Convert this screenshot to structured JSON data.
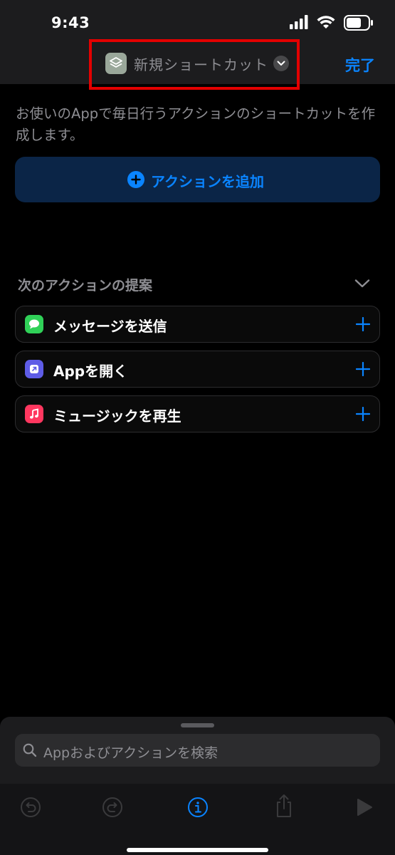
{
  "status_bar": {
    "time": "9:43"
  },
  "nav": {
    "title": "新規ショートカット",
    "done_label": "完了",
    "icon": "shortcuts-stack-icon"
  },
  "description": "お使いのAppで毎日行うアクションのショートカットを作成します。",
  "add_action": {
    "label": "アクションを追加"
  },
  "suggestions": {
    "header": "次のアクションの提案",
    "items": [
      {
        "label": "メッセージを送信",
        "icon": "messages-icon",
        "color": "#30d158"
      },
      {
        "label": "Appを開く",
        "icon": "open-app-icon",
        "color": "#5e5ce6"
      },
      {
        "label": "ミュージックを再生",
        "icon": "music-icon",
        "color": "#ff375f"
      }
    ]
  },
  "search": {
    "placeholder": "Appおよびアクションを検索"
  },
  "toolbar": {
    "items": [
      "undo-icon",
      "redo-icon",
      "info-icon",
      "share-icon",
      "play-icon"
    ]
  },
  "colors": {
    "accent": "#0a84ff",
    "highlight": "#e30000",
    "background": "#000000",
    "surface": "#1c1c1e"
  }
}
